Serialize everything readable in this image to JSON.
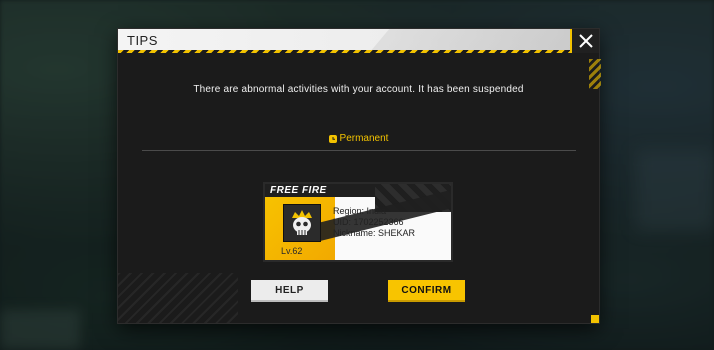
{
  "dialog": {
    "title": "TIPS",
    "message": "There are abnormal activities with your account. It has been suspended",
    "duration_label": "Permanent"
  },
  "profile_card": {
    "logo_text": "FREE FIRE",
    "region": "Region: India",
    "uid": "UID: 1702252366",
    "nickname": "Nickname: SHEKAR",
    "level": "Lv.62"
  },
  "buttons": {
    "help_label": "HELP",
    "confirm_label": "CONFIRM"
  },
  "colors": {
    "accent": "#f2c200",
    "panel": "#1b1b1b",
    "title_bar": "#f4f4f4"
  },
  "icons": {
    "close": "close-icon",
    "clock": "clock-icon",
    "avatar": "skull-crown-avatar"
  }
}
